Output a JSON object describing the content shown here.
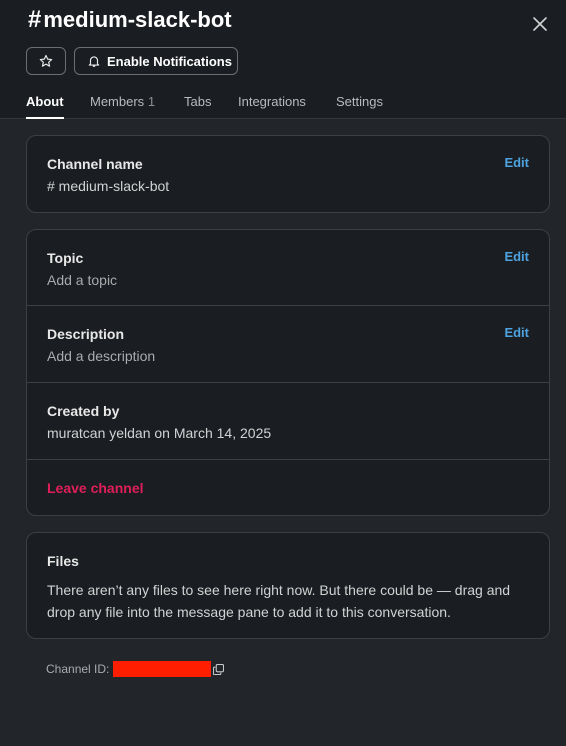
{
  "header": {
    "channel_prefix": "#",
    "channel_name": "medium-slack-bot",
    "notifications_label": "Enable Notifications"
  },
  "tabs": [
    {
      "label": "About"
    },
    {
      "label": "Members",
      "count": "1"
    },
    {
      "label": "Tabs"
    },
    {
      "label": "Integrations"
    },
    {
      "label": "Settings"
    }
  ],
  "channel_card": {
    "label": "Channel name",
    "value": "# medium-slack-bot",
    "edit_label": "Edit"
  },
  "info_card": {
    "topic_label": "Topic",
    "topic_value": "Add a topic",
    "topic_edit": "Edit",
    "description_label": "Description",
    "description_value": "Add a description",
    "description_edit": "Edit",
    "created_label": "Created by",
    "created_value": "muratcan yeldan on March 14, 2025",
    "leave_label": "Leave channel"
  },
  "files_card": {
    "label": "Files",
    "text": "There aren’t any files to see here right now. But there could be — drag and drop any file into the message pane to add it to this conversation."
  },
  "channel_id": {
    "label": "Channel ID:"
  },
  "colors": {
    "accent_link": "#4da3e0",
    "danger": "#e01e5a",
    "redaction": "#ff1f00"
  }
}
